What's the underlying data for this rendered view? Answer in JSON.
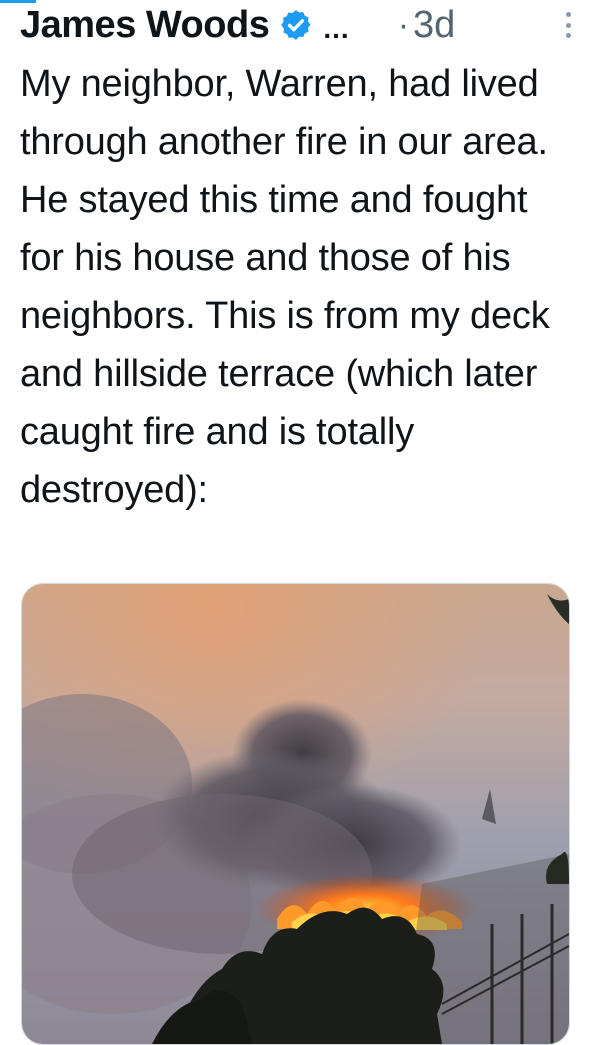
{
  "tweet": {
    "author": "James Woods",
    "more": "...",
    "separator": "·",
    "time": "3d",
    "text": "My neighbor, Warren, had lived through another fire in our area. He stayed this time and fought for his house and those of his neighbors. This is from my deck and hillside terrace (which later caught fire and is totally destroyed):"
  },
  "icons": {
    "verified": "verified-badge-icon",
    "overflow": "vertical-ellipsis-icon"
  },
  "colors": {
    "accent": "#1d9bf0",
    "text": "#0f1419",
    "muted": "#536471"
  }
}
